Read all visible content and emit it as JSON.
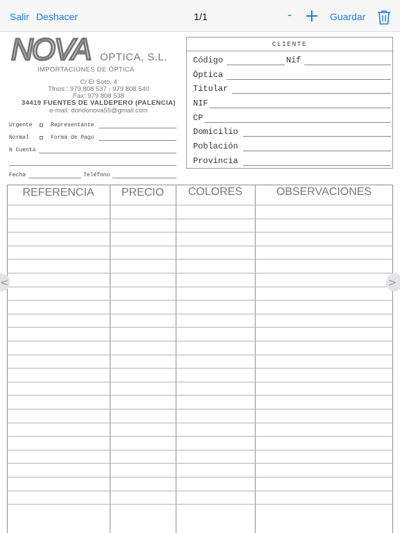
{
  "toolbar": {
    "exit_label": "Salir",
    "undo_label": "Deshacer",
    "page_indicator": "1/1",
    "minus_label": "-",
    "save_label": "Guardar",
    "add_icon": "plus-icon",
    "delete_icon": "trash-icon",
    "accent_color": "#1a7cf2"
  },
  "company": {
    "logo_text": "NOVA",
    "name": "OPTICA, S.L.",
    "subtitle": "IMPORTACIONES DE ÓPTICA",
    "address": "C/ El Soto, 4",
    "phones": "Tfnos.: 979 808 537 - 979 808 540",
    "fax": "Fax: 979 808 538",
    "city": "34419 FUENTES DE VALDEPERO (PALENCIA)",
    "email": "e-mail: dondonova55@gmail.com"
  },
  "order_fields": {
    "urgent": "Urgente",
    "representative": "Representante",
    "normal": "Normal",
    "payment": "Forma de Pago",
    "account": "N Cuenta",
    "date": "Fecha",
    "phone": "Teléfono"
  },
  "client": {
    "title": "CLIENTE",
    "code": "Código",
    "nif_inline": "Nif",
    "optica": "Óptica",
    "holder": "Titular",
    "nif": "NIF",
    "cp": "CP",
    "address": "Domicilio",
    "town": "Población",
    "province": "Provincia"
  },
  "table": {
    "columns": [
      "REFERENCIA",
      "PRECIO",
      "COLORES",
      "OBSERVACIONES"
    ],
    "empty_rows": 23
  },
  "nav": {
    "prev_icon": "chevron-left-icon",
    "next_icon": "chevron-right-icon"
  }
}
